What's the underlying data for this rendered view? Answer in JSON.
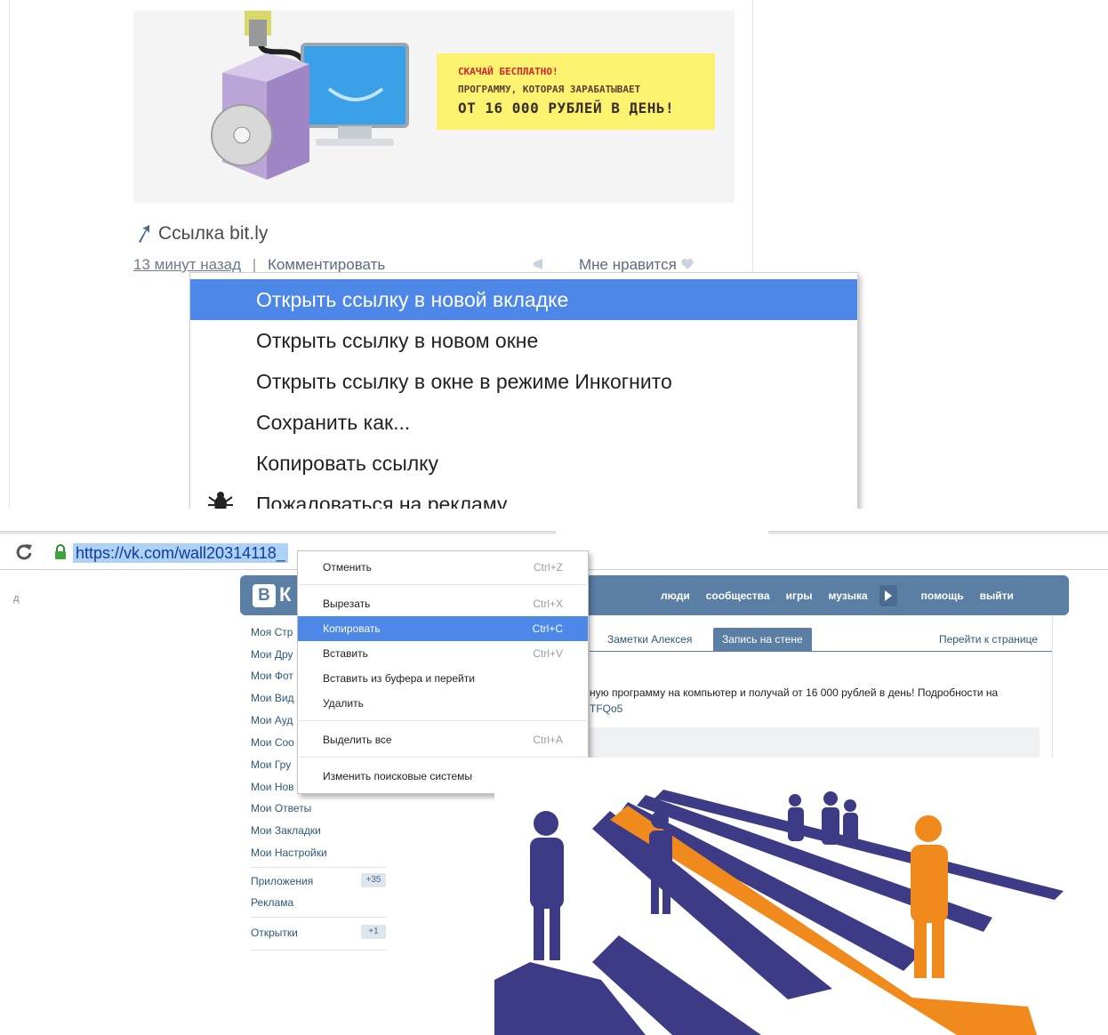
{
  "ad": {
    "banner_line1": "СКАЧАЙ БЕСПЛАТНО!",
    "banner_line2": "ПРОГРАММУ, КОТОРАЯ ЗАРАБАТЫВАЕТ",
    "banner_line3": "ОТ 16 000 РУБЛЕЙ В ДЕНЬ!",
    "link_label": "Ссылка bit.ly",
    "time_ago": "13 минут назад",
    "separator": "|",
    "comment": "Комментировать",
    "like": "Мне нравится",
    "colors": {
      "banner": "#fbf26f",
      "banner_red": "#d2262c"
    }
  },
  "context_menu_large": {
    "items": [
      {
        "label": "Открыть ссылку в новой вкладке",
        "highlighted": true
      },
      {
        "label": "Открыть ссылку в новом окне",
        "highlighted": false
      },
      {
        "label": "Открыть ссылку в окне в режиме Инкогнито",
        "highlighted": false
      },
      {
        "label": "Сохранить как...",
        "highlighted": false
      },
      {
        "label": "Копировать ссылку",
        "highlighted": false
      },
      {
        "label": "Пожаловаться на рекламу",
        "highlighted": false,
        "icon": "bug-icon"
      }
    ],
    "highlight_color": "#4d87e8"
  },
  "browser": {
    "url": "https://vk.com/wall20314118_",
    "reload_icon": "reload-icon",
    "lock_icon": "lock-icon",
    "side_letter": "д"
  },
  "vk": {
    "logo_letter": "В",
    "logo_text": "К",
    "nav": [
      "люди",
      "сообщества",
      "игры",
      "музыка",
      "помощь",
      "выйти"
    ],
    "sidebar": [
      {
        "label": "Моя Стр"
      },
      {
        "label": "Мои Дру"
      },
      {
        "label": "Мои Фот"
      },
      {
        "label": "Мои Вид"
      },
      {
        "label": "Мои Ауд"
      },
      {
        "label": "Мои Соо"
      },
      {
        "label": "Мои Гру"
      },
      {
        "label": "Мои Нов"
      },
      {
        "label": "Мои Ответы"
      },
      {
        "label": "Мои Закладки"
      },
      {
        "label": "Мои Настройки"
      }
    ],
    "apps": {
      "label": "Приложения",
      "count": "+35"
    },
    "ads_label": "Реклама",
    "cards": {
      "label": "Открытки",
      "count": "+1"
    },
    "tabs": [
      "Заметки Алексея",
      "Запись на стене"
    ],
    "go_to_page": "Перейти к странице",
    "post_text": "ную программу на компьютер и получай от 16 000 рублей в день! Подробности на",
    "post_link": "TFQo5",
    "header_color": "#5b7ea4"
  },
  "context_menu_small": {
    "items": [
      {
        "label": "Отменить",
        "shortcut": "Ctrl+Z"
      },
      {
        "label": "Вырезать",
        "shortcut": "Ctrl+X"
      },
      {
        "label": "Копировать",
        "shortcut": "Ctrl+C",
        "highlighted": true
      },
      {
        "label": "Вставить",
        "shortcut": "Ctrl+V"
      },
      {
        "label": "Вставить из буфера и перейти",
        "shortcut": ""
      },
      {
        "label": "Удалить",
        "shortcut": ""
      },
      {
        "label": "Выделить все",
        "shortcut": "Ctrl+A"
      },
      {
        "label": "Изменить поисковые системы",
        "shortcut": ""
      }
    ]
  },
  "illustration": {
    "icon": "people-arrows-illustration",
    "accent": "#f08a1c",
    "main": "#3d3a86"
  }
}
